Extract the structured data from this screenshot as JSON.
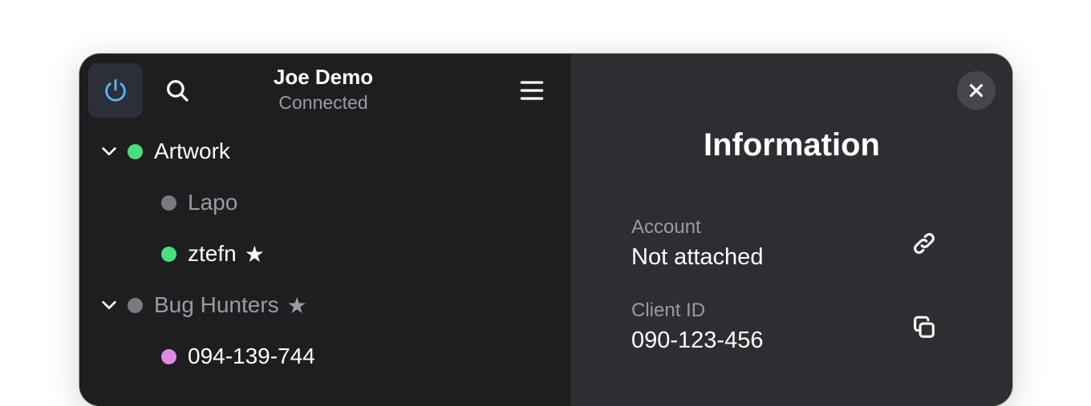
{
  "header": {
    "user_name": "Joe Demo",
    "status": "Connected",
    "icons": {
      "power": "power-icon",
      "search": "search-icon",
      "menu": "hamburger-menu-icon"
    }
  },
  "tree": [
    {
      "label": "Artwork",
      "level": 0,
      "expanded": true,
      "status_color": "#4ade80",
      "text_color": "#ffffff",
      "starred": false
    },
    {
      "label": "Lapo",
      "level": 1,
      "status_color": "#7a7a7e",
      "text_color": "#9a9aa0",
      "starred": false
    },
    {
      "label": "ztefn",
      "level": 1,
      "status_color": "#4ade80",
      "text_color": "#ffffff",
      "starred": true,
      "star": "★"
    },
    {
      "label": "Bug Hunters",
      "level": 0,
      "expanded": true,
      "status_color": "#7a7a7e",
      "text_color": "#9a9aa0",
      "starred": true,
      "star": "★"
    },
    {
      "label": "094-139-744",
      "level": 1,
      "status_color": "#e08ae6",
      "text_color": "#ffffff",
      "starred": false
    }
  ],
  "info": {
    "title": "Information",
    "close_icon": "close-icon",
    "fields": [
      {
        "label": "Account",
        "value": "Not attached",
        "icon": "link-icon"
      },
      {
        "label": "Client ID",
        "value": "090-123-456",
        "icon": "copy-icon"
      }
    ]
  },
  "colors": {
    "accent": "#5fb4f5",
    "left_bg": "#1e1e20",
    "right_bg": "#2e2e32",
    "online": "#4ade80",
    "offline": "#7a7a7e"
  }
}
